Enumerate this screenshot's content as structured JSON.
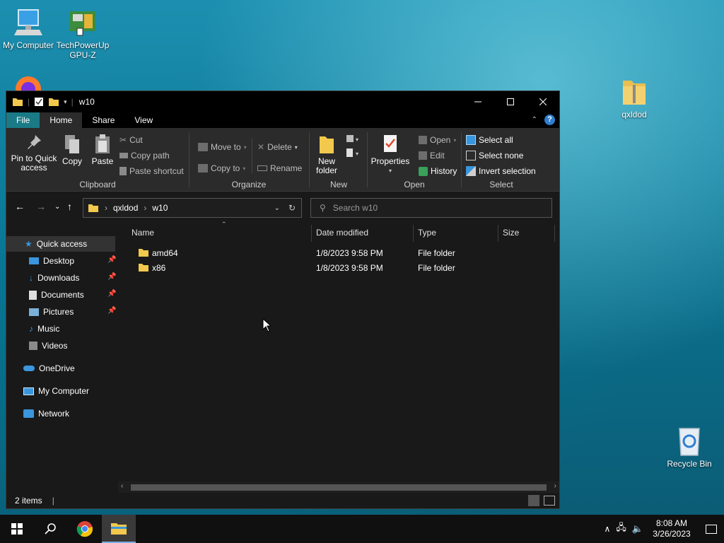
{
  "desktop": {
    "icons": [
      {
        "label": "My Computer"
      },
      {
        "label": "TechPowerUp GPU-Z"
      },
      {
        "label": "qxldod"
      },
      {
        "label": "Recycle Bin"
      }
    ]
  },
  "window": {
    "title": "w10",
    "ribbon_tabs": [
      "File",
      "Home",
      "Share",
      "View"
    ],
    "clipboard": {
      "label": "Clipboard",
      "pin": "Pin to Quick access",
      "copy": "Copy",
      "paste": "Paste",
      "cut": "Cut",
      "copy_path": "Copy path",
      "paste_shortcut": "Paste shortcut"
    },
    "organize": {
      "label": "Organize",
      "move_to": "Move to",
      "copy_to": "Copy to",
      "delete": "Delete",
      "rename": "Rename"
    },
    "new": {
      "label": "New",
      "new_folder": "New folder"
    },
    "open": {
      "label": "Open",
      "properties": "Properties",
      "open": "Open",
      "edit": "Edit",
      "history": "History"
    },
    "select": {
      "label": "Select",
      "select_all": "Select all",
      "select_none": "Select none",
      "invert": "Invert selection"
    },
    "address": {
      "crumbs": [
        "qxldod",
        "w10"
      ],
      "search_placeholder": "Search w10"
    },
    "nav": {
      "quick_access": "Quick access",
      "items": [
        "Desktop",
        "Downloads",
        "Documents",
        "Pictures",
        "Music",
        "Videos"
      ],
      "onedrive": "OneDrive",
      "my_computer": "My Computer",
      "network": "Network"
    },
    "columns": [
      "Name",
      "Date modified",
      "Type",
      "Size"
    ],
    "files": [
      {
        "name": "amd64",
        "date": "1/8/2023 9:58 PM",
        "type": "File folder",
        "size": ""
      },
      {
        "name": "x86",
        "date": "1/8/2023 9:58 PM",
        "type": "File folder",
        "size": ""
      }
    ],
    "status": "2 items"
  },
  "taskbar": {
    "time": "8:08 AM",
    "date": "3/26/2023"
  },
  "colors": {
    "file_tab": "#1a7a86",
    "folder": "#f2c94c",
    "accent": "#3a96dd"
  }
}
